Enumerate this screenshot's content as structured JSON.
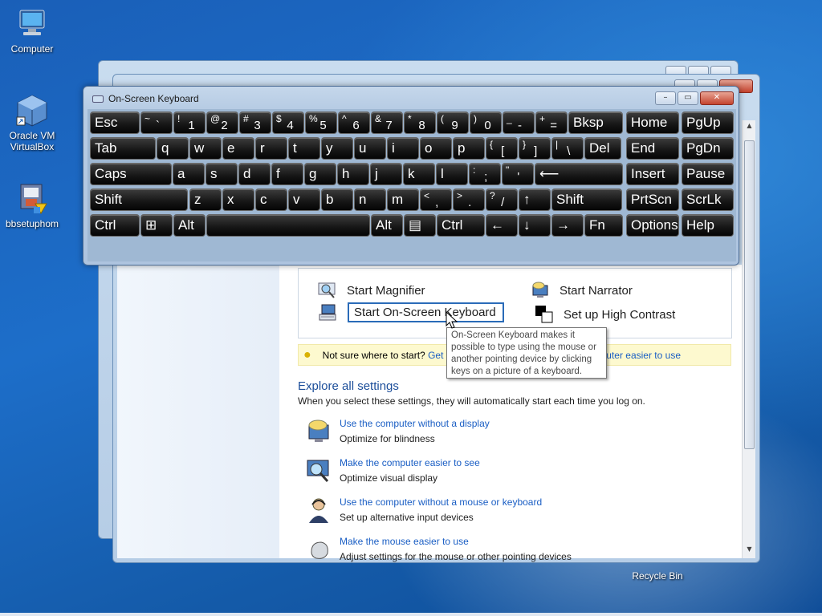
{
  "desktop": {
    "icons": [
      {
        "label": "Computer"
      },
      {
        "label_line1": "Oracle VM",
        "label_line2": "VirtualBox"
      },
      {
        "label": "bbsetuphom"
      },
      {
        "label": "Recycle Bin"
      }
    ]
  },
  "osk": {
    "title": "On-Screen Keyboard",
    "window_buttons": {
      "minimize": "–",
      "restore": "▭",
      "close": "✕"
    },
    "row1": [
      {
        "main": "Esc"
      },
      {
        "hi": "~",
        "lo": "`"
      },
      {
        "hi": "!",
        "lo": "1"
      },
      {
        "hi": "@",
        "lo": "2"
      },
      {
        "hi": "#",
        "lo": "3"
      },
      {
        "hi": "$",
        "lo": "4"
      },
      {
        "hi": "%",
        "lo": "5"
      },
      {
        "hi": "^",
        "lo": "6"
      },
      {
        "hi": "&",
        "lo": "7"
      },
      {
        "hi": "*",
        "lo": "8"
      },
      {
        "hi": "(",
        "lo": "9"
      },
      {
        "hi": ")",
        "lo": "0"
      },
      {
        "hi": "_",
        "lo": "-"
      },
      {
        "hi": "+",
        "lo": "="
      },
      {
        "main": "Bksp"
      },
      {
        "main": "Home"
      },
      {
        "main": "PgUp"
      }
    ],
    "row2": [
      {
        "main": "Tab"
      },
      {
        "main": "q"
      },
      {
        "main": "w"
      },
      {
        "main": "e"
      },
      {
        "main": "r"
      },
      {
        "main": "t"
      },
      {
        "main": "y"
      },
      {
        "main": "u"
      },
      {
        "main": "i"
      },
      {
        "main": "o"
      },
      {
        "main": "p"
      },
      {
        "hi": "{",
        "lo": "["
      },
      {
        "hi": "}",
        "lo": "]"
      },
      {
        "hi": "|",
        "lo": "\\"
      },
      {
        "main": "Del"
      },
      {
        "main": "End"
      },
      {
        "main": "PgDn"
      }
    ],
    "row3": [
      {
        "main": "Caps"
      },
      {
        "main": "a"
      },
      {
        "main": "s"
      },
      {
        "main": "d"
      },
      {
        "main": "f"
      },
      {
        "main": "g"
      },
      {
        "main": "h"
      },
      {
        "main": "j"
      },
      {
        "main": "k"
      },
      {
        "main": "l"
      },
      {
        "hi": ":",
        "lo": ";"
      },
      {
        "hi": "\"",
        "lo": "'"
      },
      {
        "main": "⟵"
      },
      {
        "main": "Insert"
      },
      {
        "main": "Pause"
      }
    ],
    "row4": [
      {
        "main": "Shift"
      },
      {
        "main": "z"
      },
      {
        "main": "x"
      },
      {
        "main": "c"
      },
      {
        "main": "v"
      },
      {
        "main": "b"
      },
      {
        "main": "n"
      },
      {
        "main": "m"
      },
      {
        "hi": "<",
        "lo": ","
      },
      {
        "hi": ">",
        "lo": "."
      },
      {
        "hi": "?",
        "lo": "/"
      },
      {
        "main": "↑"
      },
      {
        "main": "Shift"
      },
      {
        "main": "PrtScn"
      },
      {
        "main": "ScrLk"
      }
    ],
    "row5": [
      {
        "main": "Ctrl"
      },
      {
        "main": "⊞"
      },
      {
        "main": "Alt"
      },
      {
        "main": ""
      },
      {
        "main": "Alt"
      },
      {
        "main": "▤"
      },
      {
        "main": "Ctrl"
      },
      {
        "main": "←"
      },
      {
        "main": "↓"
      },
      {
        "main": "→"
      },
      {
        "main": "Fn"
      },
      {
        "main": "Options"
      },
      {
        "main": "Help"
      }
    ]
  },
  "ease": {
    "quick": {
      "magnifier": "Start Magnifier",
      "narrator": "Start Narrator",
      "osk": "Start On-Screen Keyboard",
      "contrast": "Set up High Contrast"
    },
    "tip": {
      "text": "Not sure where to start?",
      "link_start": "Get",
      "link_end": "mputer easier to use"
    },
    "tooltip": "On-Screen Keyboard makes it possible to type using the mouse or another pointing device by clicking keys on a picture of a keyboard.",
    "explore": {
      "title": "Explore all settings",
      "subtitle": "When you select these settings, they will automatically start each time you log on.",
      "items": [
        {
          "link": "Use the computer without a display",
          "desc": "Optimize for blindness",
          "icon": "display-speech-icon"
        },
        {
          "link": "Make the computer easier to see",
          "desc": "Optimize visual display",
          "icon": "magnifier-monitor-icon"
        },
        {
          "link": "Use the computer without a mouse or keyboard",
          "desc": "Set up alternative input devices",
          "icon": "person-headset-icon"
        },
        {
          "link": "Make the mouse easier to use",
          "desc": "Adjust settings for the mouse or other pointing devices",
          "icon": "mouse-icon"
        }
      ]
    }
  }
}
